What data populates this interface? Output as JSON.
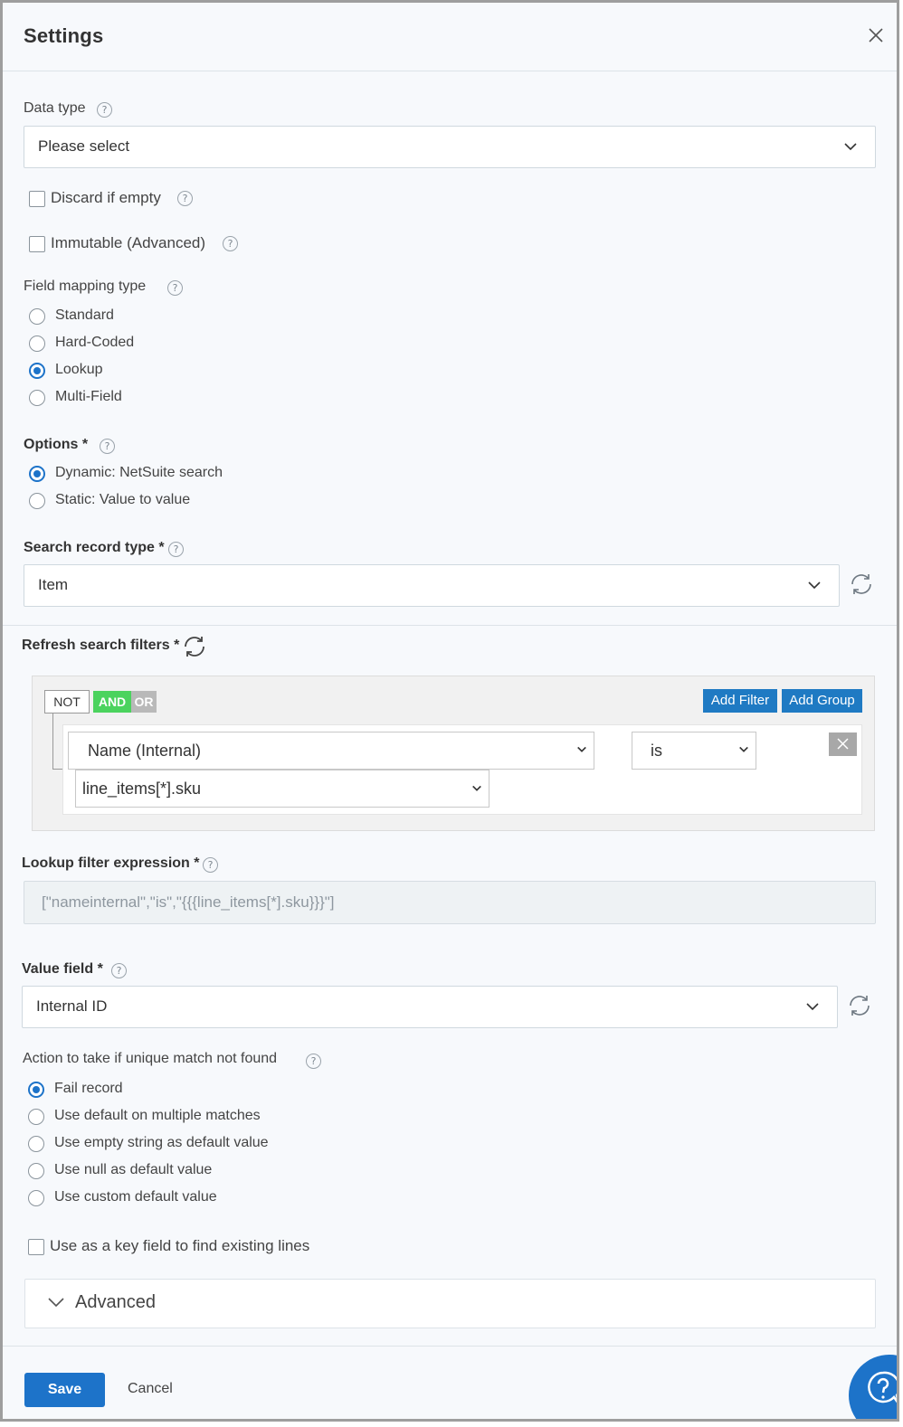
{
  "header": {
    "title": "Settings"
  },
  "data_type": {
    "label": "Data type",
    "value": "Please select"
  },
  "discard_if_empty": {
    "label": "Discard if empty",
    "checked": false
  },
  "immutable": {
    "label": "Immutable (Advanced)",
    "checked": false
  },
  "field_mapping_type": {
    "label": "Field mapping type",
    "options": [
      "Standard",
      "Hard-Coded",
      "Lookup",
      "Multi-Field"
    ],
    "selected": "Lookup"
  },
  "options": {
    "label": "Options *",
    "choices": [
      "Dynamic: NetSuite search",
      "Static: Value to value"
    ],
    "selected": "Dynamic: NetSuite search"
  },
  "search_record_type": {
    "label": "Search record type *",
    "value": "Item"
  },
  "refresh_search_filters": {
    "label": "Refresh search filters *"
  },
  "filter_builder": {
    "not_label": "NOT",
    "and_label": "AND",
    "or_label": "OR",
    "add_filter_label": "Add Filter",
    "add_group_label": "Add Group",
    "rule": {
      "field": "Name (Internal)",
      "operator": "is",
      "value": "line_items[*].sku"
    }
  },
  "lookup_filter_expression": {
    "label": "Lookup filter expression *",
    "value": "[\"nameinternal\",\"is\",\"{{{line_items[*].sku}}}\"]"
  },
  "value_field": {
    "label": "Value field *",
    "value": "Internal ID"
  },
  "unique_match_action": {
    "label": "Action to take if unique match not found",
    "options": [
      "Fail record",
      "Use default on multiple matches",
      "Use empty string as default value",
      "Use null as default value",
      "Use custom default value"
    ],
    "selected": "Fail record"
  },
  "key_field": {
    "label": "Use as a key field to find existing lines",
    "checked": false
  },
  "advanced": {
    "label": "Advanced"
  },
  "footer": {
    "save_label": "Save",
    "cancel_label": "Cancel"
  },
  "icons": {
    "help": "?",
    "close": "close-icon",
    "chevron": "chevron-down-icon",
    "refresh": "refresh-icon"
  },
  "colors": {
    "primary": "#1d73c9",
    "and_active": "#4bd35e",
    "or_inactive": "#b9b9b9",
    "filter_button": "#1f7ac3"
  }
}
